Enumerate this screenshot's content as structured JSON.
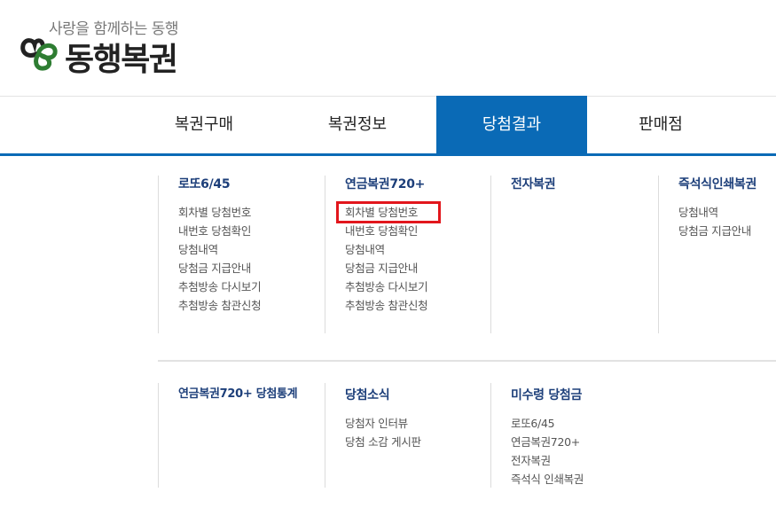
{
  "logo": {
    "tagline": "사랑을 함께하는 동행",
    "name": "동행복권",
    "colors": {
      "green": "#2e7d32",
      "dark": "#222222"
    }
  },
  "nav": {
    "active_color": "#0a6ab6",
    "items": [
      {
        "label": "복권구매",
        "active": false
      },
      {
        "label": "복권정보",
        "active": false
      },
      {
        "label": "당첨결과",
        "active": true
      },
      {
        "label": "판매점",
        "active": false
      }
    ]
  },
  "menu": {
    "row1": [
      {
        "title": "로또6/45",
        "items": [
          "회차별 당첨번호",
          "내번호 당첨확인",
          "당첨내역",
          "당첨금 지급안내",
          "추첨방송 다시보기",
          "추첨방송 참관신청"
        ]
      },
      {
        "title": "연금복권720+",
        "items": [
          "회차별 당첨번호",
          "내번호 당첨확인",
          "당첨내역",
          "당첨금 지급안내",
          "추첨방송 다시보기",
          "추첨방송 참관신청"
        ],
        "highlighted_item": "회차별 당첨번호"
      },
      {
        "title": "전자복권",
        "items": []
      },
      {
        "title": "즉석식인쇄복권",
        "items": [
          "당첨내역",
          "당첨금 지급안내"
        ]
      }
    ],
    "row2": [
      {
        "title": "연금복권720+ 당첨통계",
        "items": []
      },
      {
        "title": "당첨소식",
        "items": [
          "당첨자 인터뷰",
          "당첨 소감 게시판"
        ]
      },
      {
        "title": "미수령 당첨금",
        "items": [
          "로또6/45",
          "연금복권720+",
          "전자복권",
          "즉석식 인쇄복권"
        ]
      }
    ]
  }
}
